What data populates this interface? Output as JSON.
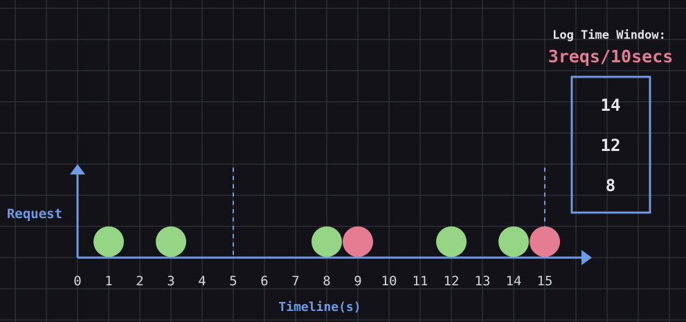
{
  "colors": {
    "background": "#121218",
    "grid": "#3a3a44",
    "axis": "#6f9be6",
    "green": "#96d586",
    "red": "#e57c92",
    "text": "#d4d4dc",
    "window_box": "#6f9be6"
  },
  "labels": {
    "y_axis": "Request",
    "x_axis": "Timeline(s)",
    "window_title": "Log Time Window:",
    "window_rate": "3reqs/10secs"
  },
  "ticks": [
    "0",
    "1",
    "2",
    "3",
    "4",
    "5",
    "6",
    "7",
    "8",
    "9",
    "10",
    "11",
    "12",
    "13",
    "14",
    "15"
  ],
  "window_markers": [
    5,
    15
  ],
  "requests": [
    {
      "t": 1,
      "status": "accepted"
    },
    {
      "t": 3,
      "status": "accepted"
    },
    {
      "t": 8,
      "status": "accepted"
    },
    {
      "t": 9,
      "status": "rejected"
    },
    {
      "t": 12,
      "status": "accepted"
    },
    {
      "t": 14,
      "status": "accepted"
    },
    {
      "t": 15,
      "status": "rejected"
    }
  ],
  "log": {
    "entries": [
      "14",
      "12",
      "8"
    ]
  }
}
